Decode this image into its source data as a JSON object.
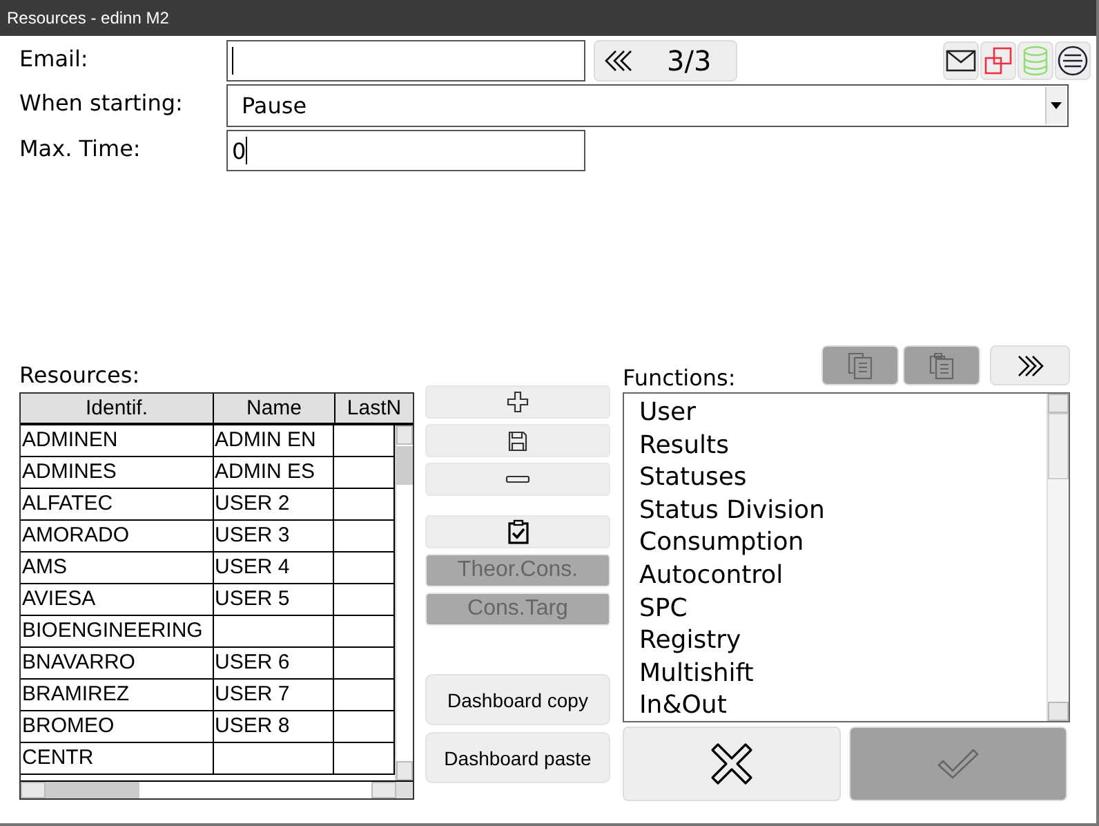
{
  "window": {
    "title": "Resources - edinn M2"
  },
  "form": {
    "email": {
      "label": "Email:"
    },
    "pager": {
      "text": "3/3",
      "disabled": false
    },
    "when_starting": {
      "label": "When starting:",
      "value": "Pause"
    },
    "max_time": {
      "label": "Max. Time:",
      "value": "0"
    }
  },
  "toolbar": [
    {
      "kind": "mail",
      "disabled": false
    },
    {
      "kind": "copy-windows",
      "disabled": false
    },
    {
      "kind": "database",
      "disabled": false
    },
    {
      "kind": "menu",
      "disabled": false
    }
  ],
  "resources": {
    "label": "Resources:",
    "columns": [
      "Identif.",
      "Name",
      "LastN"
    ],
    "rows": [
      [
        "ADMINEN",
        "ADMIN EN",
        ""
      ],
      [
        "ADMINES",
        "ADMIN ES",
        ""
      ],
      [
        "ALFATEC",
        "USER 2",
        ""
      ],
      [
        "AMORADO",
        "USER 3",
        ""
      ],
      [
        "AMS",
        "USER 4",
        ""
      ],
      [
        "AVIESA",
        "USER 5",
        ""
      ],
      [
        "BIOENGINEERING",
        "",
        ""
      ],
      [
        "BNAVARRO",
        "USER 6",
        ""
      ],
      [
        "BRAMIREZ",
        "USER 7",
        ""
      ],
      [
        "BROMEO",
        "USER 8",
        ""
      ],
      [
        "CENTR",
        "",
        ""
      ]
    ]
  },
  "actions": [
    {
      "kind": "add",
      "disabled": false
    },
    {
      "kind": "save",
      "disabled": false
    },
    {
      "kind": "remove",
      "disabled": false
    },
    {
      "kind": "check",
      "disabled": false
    },
    {
      "kind": "text",
      "label": "Theor.Cons.",
      "disabled": true
    },
    {
      "kind": "text",
      "label": "Cons.Targ",
      "disabled": true
    }
  ],
  "dashboard": [
    {
      "label": "Dashboard copy",
      "disabled": false
    },
    {
      "label": "Dashboard paste",
      "disabled": false
    }
  ],
  "functions": {
    "label": "Functions:",
    "buttons": [
      {
        "kind": "copy",
        "disabled": true
      },
      {
        "kind": "paste",
        "disabled": true
      },
      {
        "kind": "forward",
        "disabled": false
      }
    ],
    "items": [
      "User",
      "Results",
      "Statuses",
      "Status Division",
      "Consumption",
      "Autocontrol",
      "SPC",
      "Registry",
      "Multishift",
      "In&Out"
    ]
  },
  "footer": [
    {
      "kind": "cancel",
      "disabled": false
    },
    {
      "kind": "ok",
      "disabled": true
    }
  ]
}
